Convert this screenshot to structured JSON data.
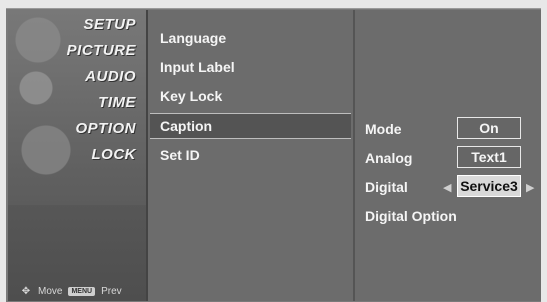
{
  "main_menu": {
    "items": [
      "SETUP",
      "PICTURE",
      "AUDIO",
      "TIME",
      "OPTION",
      "LOCK"
    ],
    "hint_move": "Move",
    "hint_prev": "Prev",
    "menu_key": "MENU",
    "move_icon": "dpad-icon"
  },
  "submenu": {
    "items": [
      "Language",
      "Input Label",
      "Key Lock",
      "Caption",
      "Set ID"
    ],
    "selected_index": 3
  },
  "caption": {
    "rows": [
      {
        "label": "Mode",
        "value": "On"
      },
      {
        "label": "Analog",
        "value": "Text1"
      },
      {
        "label": "Digital",
        "value": "Service3"
      },
      {
        "label": "Digital Option",
        "value": ""
      }
    ],
    "active_index": 2
  }
}
